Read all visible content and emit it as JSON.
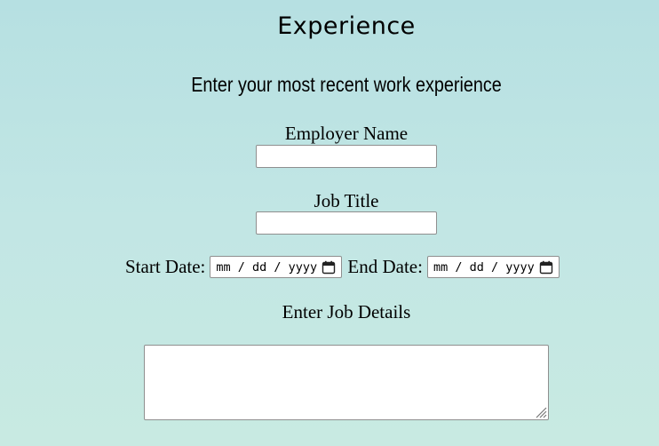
{
  "section": {
    "title": "Experience",
    "subtitle": "Enter your most recent work experience"
  },
  "form": {
    "employer_name_label": "Employer Name",
    "employer_name_value": "",
    "job_title_label": "Job Title",
    "job_title_value": "",
    "start_date_label": "Start Date:",
    "start_date_placeholder": "mm / dd / yyyy",
    "end_date_label": "End Date:",
    "end_date_placeholder": "mm / dd / yyyy",
    "job_details_label": "Enter Job Details",
    "job_details_value": ""
  },
  "icons": {
    "calendar": "calendar-icon",
    "resize": "resize-handle-icon"
  },
  "colors": {
    "background_top": "#b6e0e2",
    "background_bottom": "#c8eae2",
    "input_border": "#8f8f8f"
  }
}
